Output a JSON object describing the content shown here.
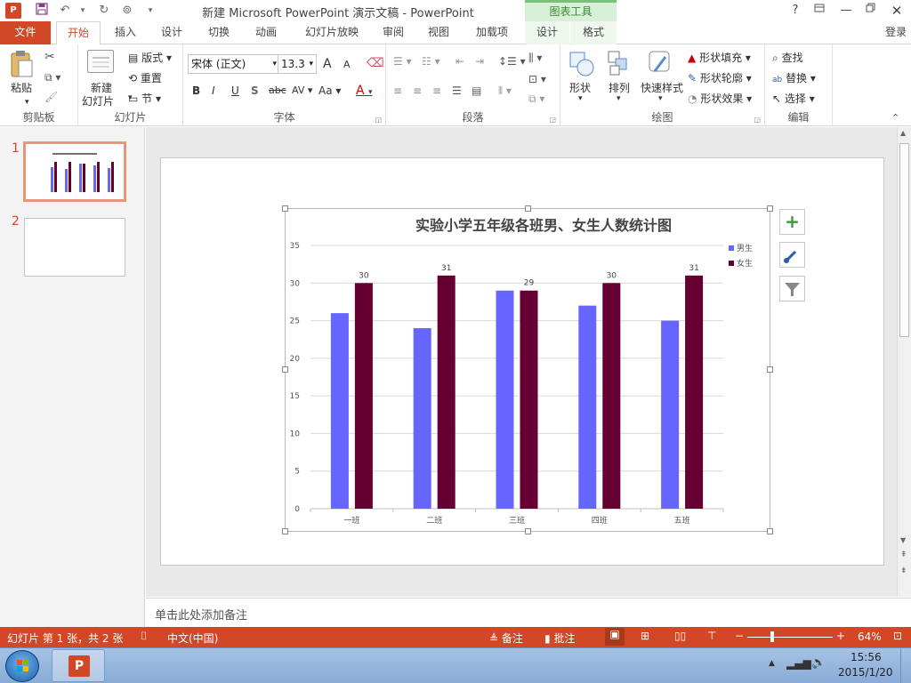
{
  "window": {
    "title": "新建 Microsoft PowerPoint 演示文稿 - PowerPoint",
    "context_tab": "图表工具",
    "help": "?",
    "login": "登录"
  },
  "tabs": [
    "文件",
    "开始",
    "插入",
    "设计",
    "切换",
    "动画",
    "幻灯片放映",
    "审阅",
    "视图",
    "加载项",
    "设计",
    "格式"
  ],
  "ribbon": {
    "clipboard": {
      "label": "剪贴板",
      "paste": "粘贴"
    },
    "slides": {
      "label": "幻灯片",
      "new_slide_1": "新建",
      "new_slide_2": "幻灯片",
      "layout": "版式",
      "reset": "重置",
      "section": "节"
    },
    "font": {
      "label": "字体",
      "font_name": "宋体 (正文)",
      "font_size": "13.3",
      "bold": "B",
      "italic": "I",
      "underline": "U",
      "shadow": "S",
      "strike": "abc",
      "spacing": "AV",
      "case": "Aa",
      "color": "A",
      "grow": "A",
      "shrink": "A"
    },
    "paragraph": {
      "label": "段落"
    },
    "drawing": {
      "label": "绘图",
      "shapes": "形状",
      "arrange": "排列",
      "quick_styles": "快速样式",
      "fill": "形状填充",
      "outline": "形状轮廓",
      "effects": "形状效果"
    },
    "editing": {
      "label": "编辑",
      "find": "查找",
      "replace": "替换",
      "select": "选择"
    }
  },
  "slides_pane": {
    "numbers": [
      "1",
      "2"
    ]
  },
  "chart_data": {
    "type": "bar",
    "title": "实验小学五年级各班男、女生人数统计图",
    "categories": [
      "一班",
      "二班",
      "三班",
      "四班",
      "五班"
    ],
    "series": [
      {
        "name": "男生",
        "values": [
          26,
          24,
          29,
          27,
          25
        ],
        "color": "#6666ff"
      },
      {
        "name": "女生",
        "values": [
          30,
          31,
          29,
          30,
          31
        ],
        "color": "#660033"
      }
    ],
    "data_labels_series": "女生",
    "ylim": [
      0,
      35
    ],
    "yticks": [
      "0",
      "5",
      "10",
      "15",
      "20",
      "25",
      "30",
      "35"
    ],
    "grid": true,
    "legend": "right"
  },
  "chart_buttons": {
    "add": "+"
  },
  "notes": {
    "placeholder": "单击此处添加备注"
  },
  "status": {
    "slide_info": "幻灯片 第 1 张，共 2 张",
    "language": "中文(中国)",
    "notes_btn": "备注",
    "comments_btn": "批注",
    "zoom": "64%"
  },
  "taskbar": {
    "time": "15:56",
    "date": "2015/1/20"
  }
}
